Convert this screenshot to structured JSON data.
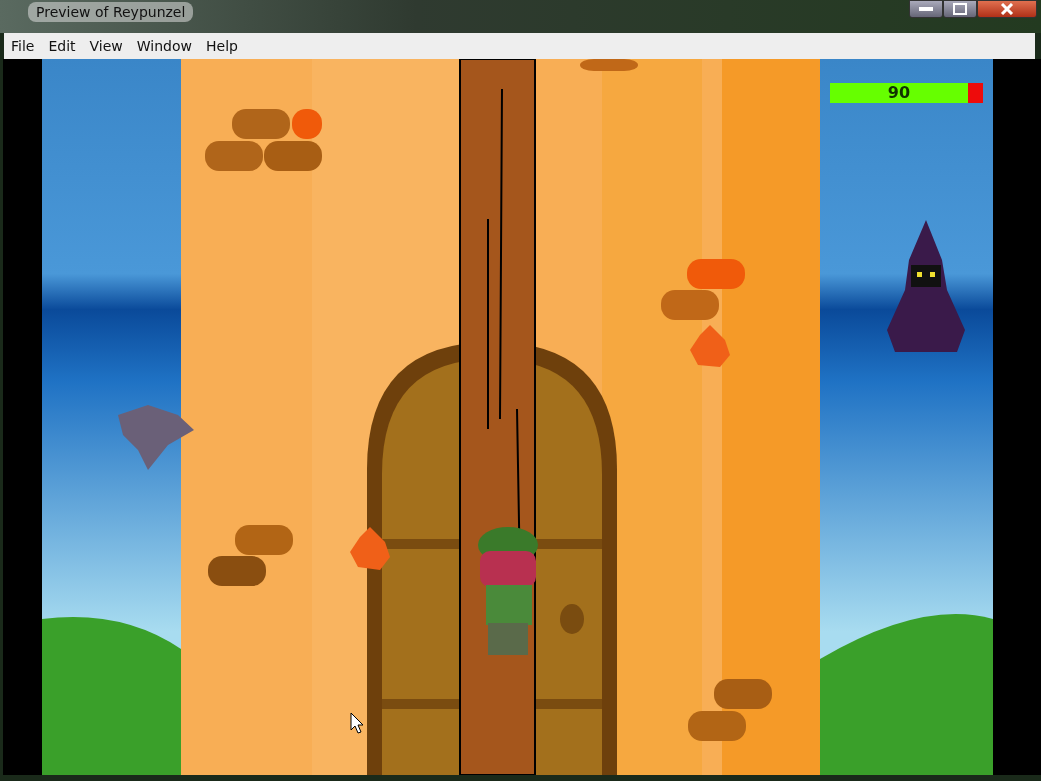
{
  "window": {
    "title": "Preview of Reypunzel"
  },
  "menu": [
    "File",
    "Edit",
    "View",
    "Window",
    "Help"
  ],
  "health": {
    "value": "90",
    "level": 0.9
  }
}
